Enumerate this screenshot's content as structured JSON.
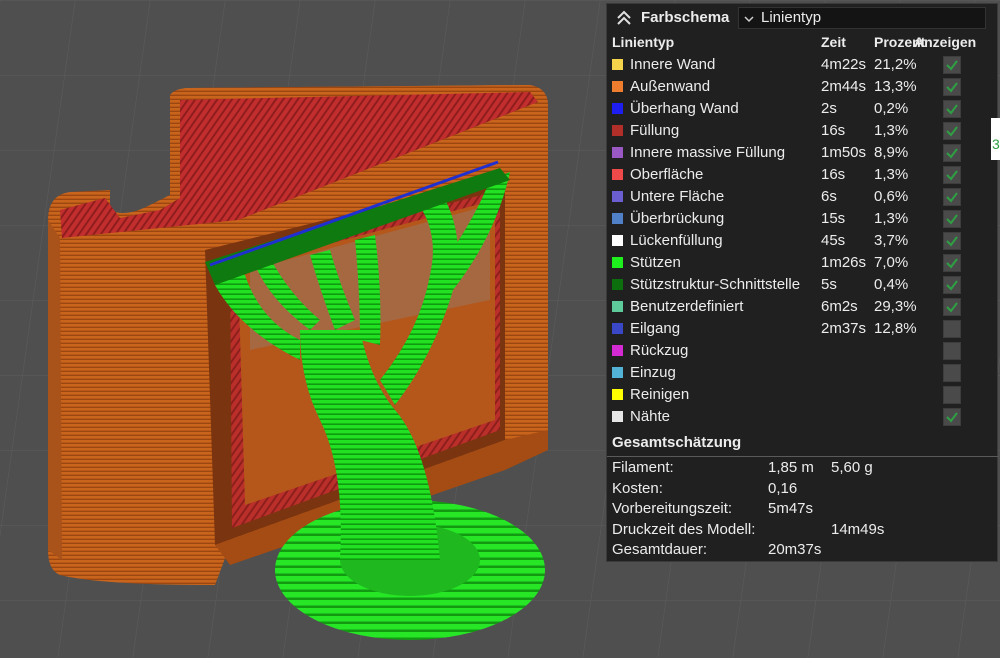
{
  "legend": {
    "title": "Farbschema",
    "view_mode": "Linientyp",
    "columns": {
      "type": "Linientyp",
      "time": "Zeit",
      "percent": "Prozent",
      "visible": "Anzeigen"
    },
    "items": [
      {
        "name": "Innere Wand",
        "time": "4m22s",
        "percent": "21,2%",
        "color": "#f5d34a",
        "checked": true
      },
      {
        "name": "Außenwand",
        "time": "2m44s",
        "percent": "13,3%",
        "color": "#ee7d2d",
        "checked": true
      },
      {
        "name": "Überhang Wand",
        "time": "2s",
        "percent": "0,2%",
        "color": "#1e1ef0",
        "checked": true
      },
      {
        "name": "Füllung",
        "time": "16s",
        "percent": "1,3%",
        "color": "#b03029",
        "checked": true
      },
      {
        "name": "Innere massive Füllung",
        "time": "1m50s",
        "percent": "8,9%",
        "color": "#9a58c4",
        "checked": true
      },
      {
        "name": "Oberfläche",
        "time": "16s",
        "percent": "1,3%",
        "color": "#ee4a4a",
        "checked": true
      },
      {
        "name": "Untere Fläche",
        "time": "6s",
        "percent": "0,6%",
        "color": "#6a5ed0",
        "checked": true
      },
      {
        "name": "Überbrückung",
        "time": "15s",
        "percent": "1,3%",
        "color": "#4f80c8",
        "checked": true
      },
      {
        "name": "Lückenfüllung",
        "time": "45s",
        "percent": "3,7%",
        "color": "#ffffff",
        "checked": true
      },
      {
        "name": "Stützen",
        "time": "1m26s",
        "percent": "7,0%",
        "color": "#1ef01e",
        "checked": true
      },
      {
        "name": "Stützstruktur-Schnittstelle",
        "time": "5s",
        "percent": "0,4%",
        "color": "#0c6e0c",
        "checked": true
      },
      {
        "name": "Benutzerdefiniert",
        "time": "6m2s",
        "percent": "29,3%",
        "color": "#5ecc9a",
        "checked": true
      },
      {
        "name": "Eilgang",
        "time": "2m37s",
        "percent": "12,8%",
        "color": "#3a48c8",
        "checked": false
      },
      {
        "name": "Rückzug",
        "time": "",
        "percent": "",
        "color": "#d42ad4",
        "checked": false
      },
      {
        "name": "Einzug",
        "time": "",
        "percent": "",
        "color": "#52b3d6",
        "checked": false
      },
      {
        "name": "Reinigen",
        "time": "",
        "percent": "",
        "color": "#ffff00",
        "checked": false
      },
      {
        "name": "Nähte",
        "time": "",
        "percent": "",
        "color": "#e6e6e6",
        "checked": true
      }
    ]
  },
  "summary": {
    "title": "Gesamtschätzung",
    "rows": [
      {
        "label": "Filament:",
        "value": "1,85 m",
        "value2": "5,60 g"
      },
      {
        "label": "Kosten:",
        "value": "0,16",
        "value2": ""
      },
      {
        "label": "Vorbereitungszeit:",
        "value": "5m47s",
        "value2": ""
      },
      {
        "label": "Druckzeit des Modell:",
        "value": "",
        "value2": "14m49s"
      },
      {
        "label": "Gesamtdauer:",
        "value": "20m37s",
        "value2": ""
      }
    ]
  },
  "edge_tab_text": "3",
  "colors": {
    "background": "#4f4f4f",
    "grid": "#5c5c5c",
    "model_orange": "#c85e18",
    "model_red": "#b82a2a",
    "support_green": "#1fd81f",
    "checkmark": "#2ea043"
  }
}
